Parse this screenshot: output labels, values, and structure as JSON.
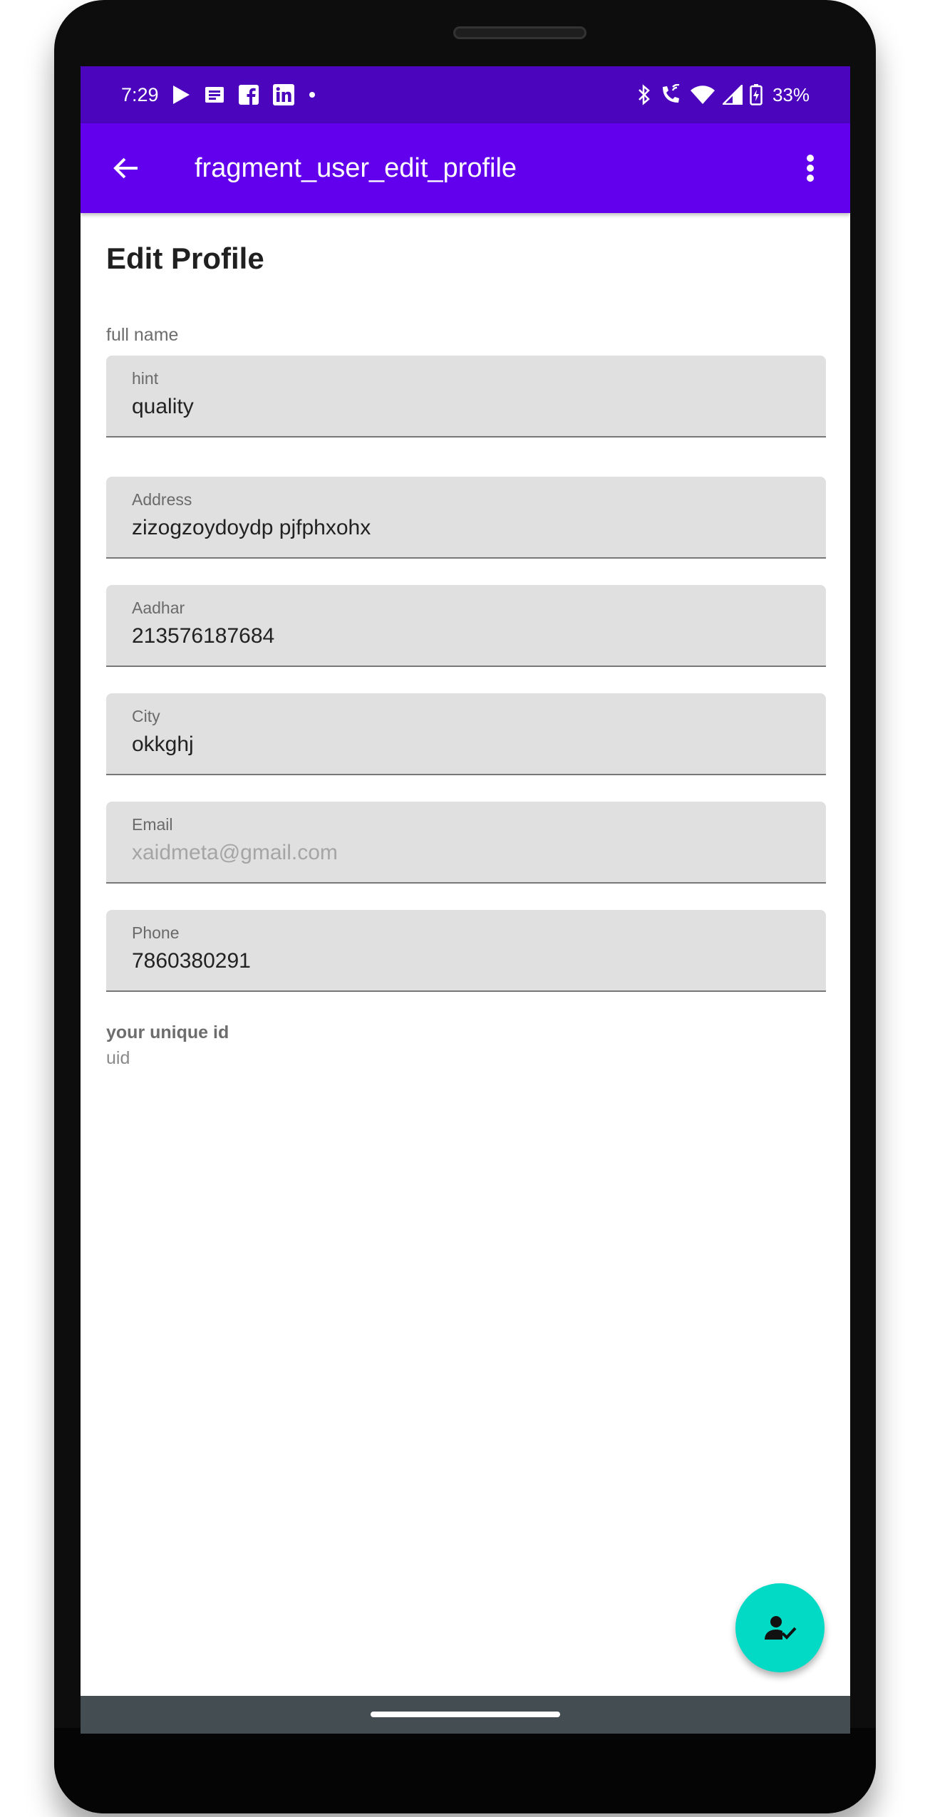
{
  "status_bar": {
    "time": "7:29",
    "battery_percent": "33%",
    "left_icons": [
      "play-store-icon",
      "news-icon",
      "facebook-icon",
      "linkedin-icon",
      "dot-icon"
    ],
    "right_icons": [
      "bluetooth-icon",
      "wifi-calling-icon",
      "wifi-icon",
      "signal-icon",
      "battery-charging-icon"
    ],
    "color": "#4a05bd"
  },
  "app_bar": {
    "title": "fragment_user_edit_profile",
    "back_icon": "arrow-back-icon",
    "menu_icon": "more-vert-icon",
    "color": "#6200ee"
  },
  "form": {
    "heading": "Edit Profile",
    "full_name_caption": "full name",
    "fields": [
      {
        "label": "hint",
        "value": "quality"
      },
      {
        "label": "Address",
        "value": "zizogzoydoydp pjfphxohx"
      },
      {
        "label": "Aadhar",
        "value": "213576187684"
      },
      {
        "label": "City",
        "value": "okkghj"
      },
      {
        "label": "Email",
        "value": "xaidmeta@gmail.com"
      },
      {
        "label": "Phone",
        "value": "7860380291"
      }
    ],
    "uid_caption": "your unique id",
    "uid_value": "uid"
  },
  "fab": {
    "icon": "person-check-icon",
    "color": "#03dac5"
  }
}
